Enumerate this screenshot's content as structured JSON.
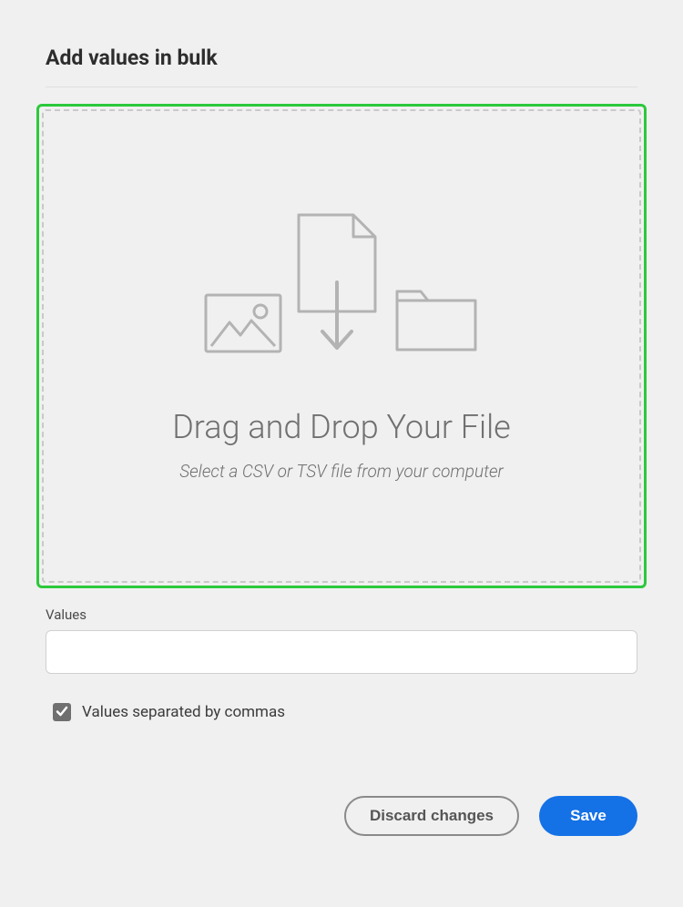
{
  "title": "Add values in bulk",
  "dropzone": {
    "heading": "Drag and Drop Your File",
    "subtitle": "Select a CSV or TSV file from your computer"
  },
  "values": {
    "label": "Values",
    "value": ""
  },
  "checkbox": {
    "label": "Values separated by commas",
    "checked": true
  },
  "buttons": {
    "discard": "Discard changes",
    "save": "Save"
  },
  "icons": {
    "image": "image-icon",
    "file": "file-download-icon",
    "folder": "folder-icon",
    "check": "check-icon"
  }
}
